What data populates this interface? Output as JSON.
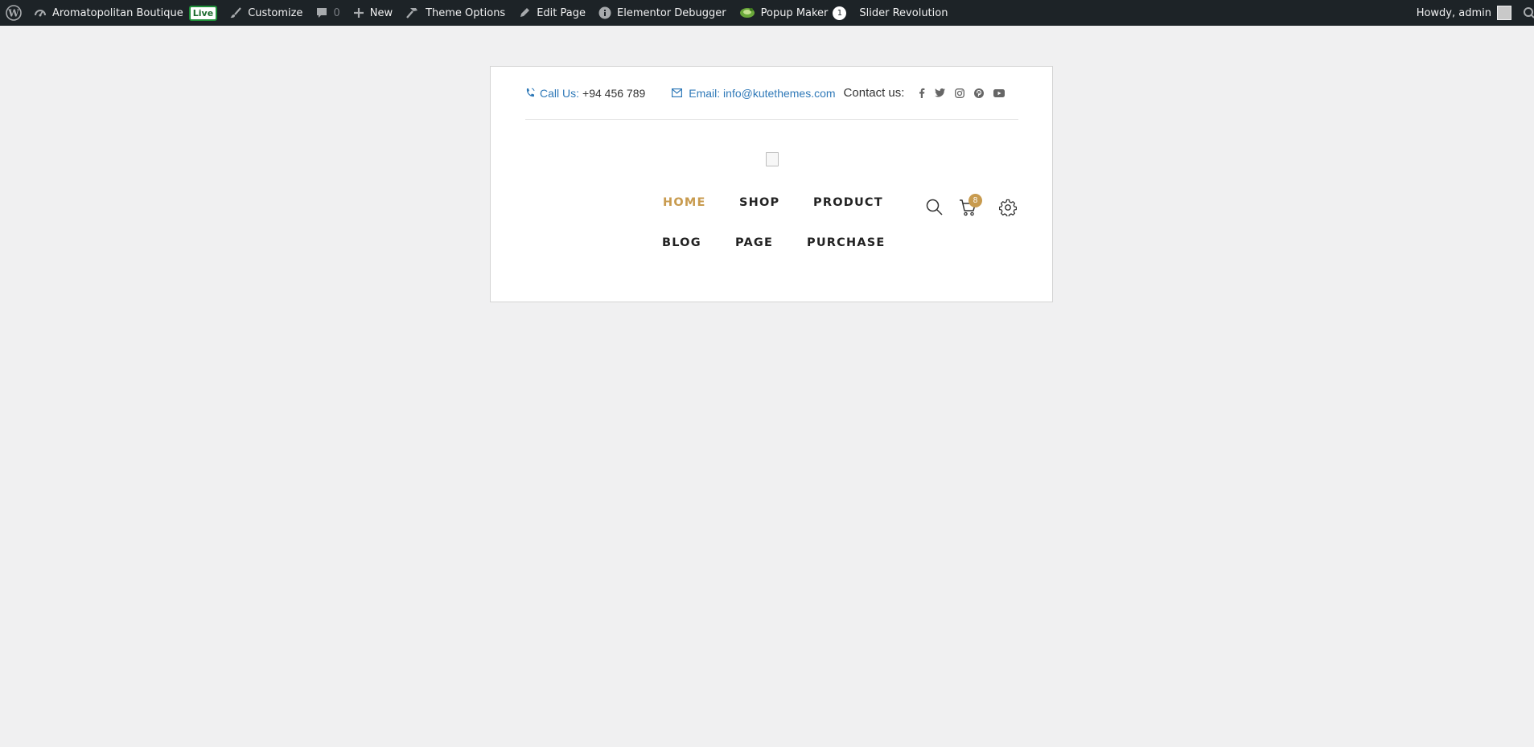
{
  "admin_bar": {
    "site_name": "Aromatopolitan Boutique",
    "live_badge": "Live",
    "customize": "Customize",
    "comments_count": "0",
    "new": "New",
    "theme_options": "Theme Options",
    "edit_page": "Edit Page",
    "elementor_debugger": "Elementor Debugger",
    "popup_maker": "Popup Maker",
    "popup_maker_count": "1",
    "slider_revolution": "Slider Revolution",
    "howdy": "Howdy, admin"
  },
  "topbar": {
    "call_label": "Call Us:",
    "call_number": "+94 456 789",
    "email_text": "Email: info@kutethemes.com",
    "contact_label": "Contact us:",
    "socials": [
      "facebook-icon",
      "twitter-icon",
      "instagram-icon",
      "pinterest-icon",
      "youtube-icon"
    ]
  },
  "nav": {
    "items": [
      "HOME",
      "SHOP",
      "PRODUCT",
      "BLOG",
      "PAGE",
      "PURCHASE"
    ],
    "active": "HOME",
    "cart_count": "8"
  },
  "colors": {
    "accent": "#c89b4f",
    "link_blue": "#2f79b8",
    "admin_bar_bg": "#1d2327",
    "page_bg": "#f0f0f1"
  }
}
